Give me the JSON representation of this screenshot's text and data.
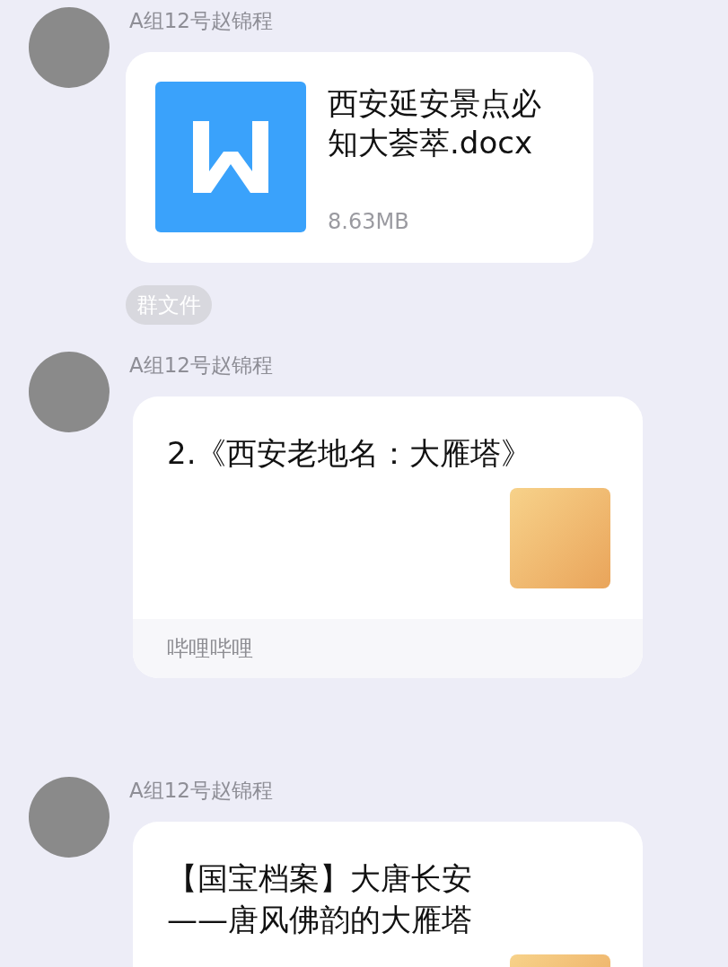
{
  "messages": [
    {
      "kind": "file",
      "sender": "A组12号赵锦程",
      "file_name": "西安延安景点必知大荟萃.docx",
      "file_size": "8.63MB",
      "tag": "群文件"
    },
    {
      "kind": "link",
      "sender": "A组12号赵锦程",
      "title_lines": [
        "2.《西安老地名：大雁塔》"
      ],
      "source": "哔哩哔哩"
    },
    {
      "kind": "link",
      "sender": "A组12号赵锦程",
      "title_lines": [
        "【国宝档案】大唐长安",
        "——唐风佛韵的大雁塔"
      ]
    }
  ]
}
